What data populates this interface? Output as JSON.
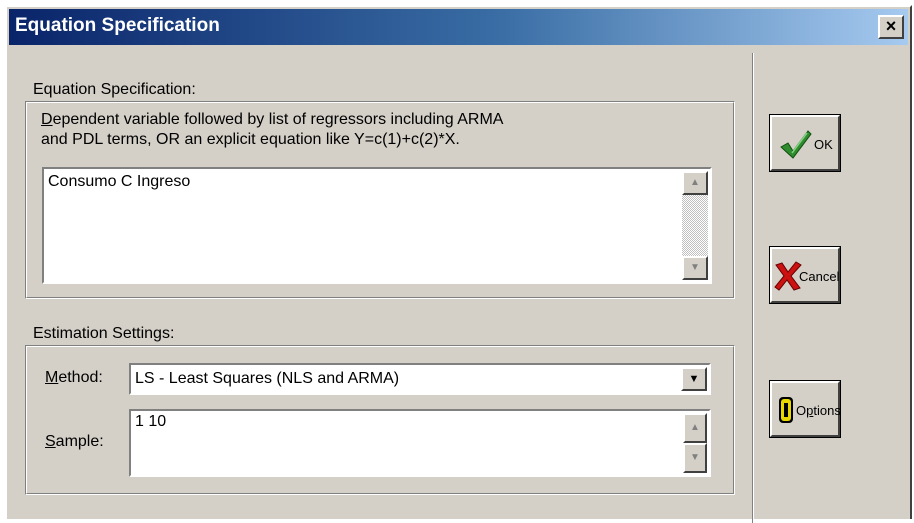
{
  "window": {
    "title": "Equation Specification",
    "close_label": "×"
  },
  "equation": {
    "group_label": "Equation Specification:",
    "desc_line1_rest": "ependent variable followed by list of regressors including ARMA",
    "desc_line1_accel": "D",
    "desc_line2": "and PDL terms, OR an explicit equation like Y=c(1)+c(2)*X.",
    "value": "Consumo  C  Ingreso"
  },
  "estimation": {
    "group_label": "Estimation Settings:",
    "method_label_accel": "M",
    "method_label_rest": "ethod:",
    "method_value": "LS - Least Squares (NLS and ARMA)",
    "sample_label_accel": "S",
    "sample_label_rest": "ample:",
    "sample_value": "1 10"
  },
  "buttons": {
    "ok_label": "OK",
    "cancel_label": "Cancel",
    "options_label_pre": "O",
    "options_label_accel": "p",
    "options_label_rest": "tions"
  },
  "icons": {
    "ok": "checkmark-icon",
    "cancel": "red-x-icon",
    "options": "yellow-o-icon",
    "scroll_up": "arrow-up-icon",
    "scroll_down": "arrow-down-icon",
    "dropdown": "chevron-down-icon"
  },
  "colors": {
    "titlebar_start": "#0a246a",
    "titlebar_end": "#a6caf0",
    "face": "#d4d0c8",
    "check_green": "#2e8b2e",
    "cancel_red": "#cc1111",
    "options_yellow": "#e8d800"
  }
}
